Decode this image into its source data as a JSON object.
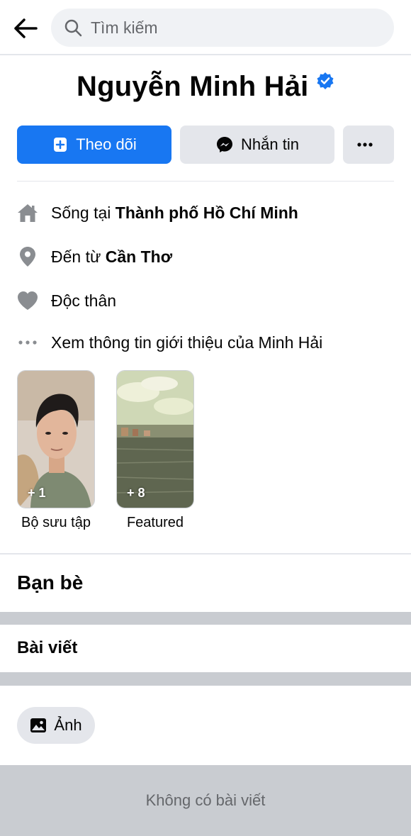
{
  "search": {
    "placeholder": "Tìm kiếm"
  },
  "profile": {
    "name": "Nguyễn Minh Hải"
  },
  "actions": {
    "follow_label": "Theo dõi",
    "message_label": "Nhắn tin"
  },
  "intro": {
    "lives_prefix": "Sống tại ",
    "lives_city": "Thành phố Hồ Chí Minh",
    "from_prefix": "Đến từ ",
    "from_city": "Cần Thơ",
    "relationship": "Độc thân",
    "see_about": "Xem thông tin giới thiệu của Minh Hải"
  },
  "collections": [
    {
      "label": "Bộ sưu tập",
      "count": "+ 1"
    },
    {
      "label": "Featured",
      "count": "+ 8"
    }
  ],
  "sections": {
    "friends": "Bạn bè",
    "posts": "Bài viết"
  },
  "filters": {
    "photos_label": "Ảnh"
  },
  "empty_state": {
    "text": "Không có bài viết"
  },
  "colors": {
    "accent": "#1877f2",
    "verified": "#1877f2",
    "grey_bg": "#e4e6eb"
  }
}
